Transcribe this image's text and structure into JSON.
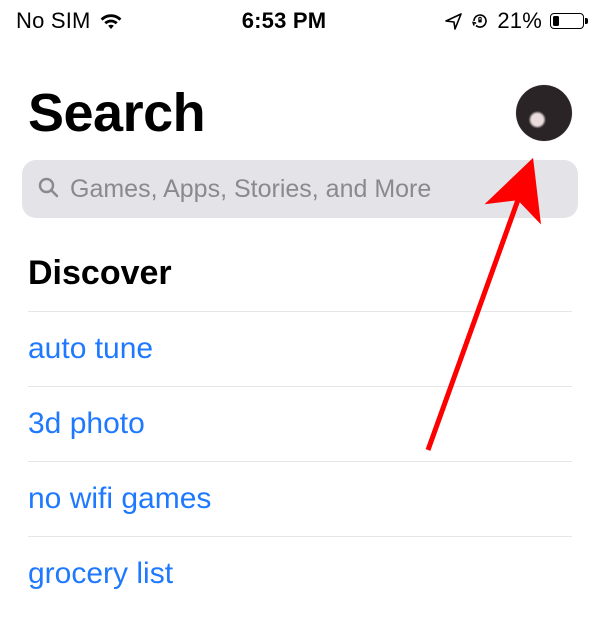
{
  "status_bar": {
    "carrier": "No SIM",
    "time": "6:53 PM",
    "battery_percent_text": "21%",
    "battery_percent": 21
  },
  "header": {
    "title": "Search"
  },
  "search": {
    "placeholder": "Games, Apps, Stories, and More"
  },
  "discover": {
    "title": "Discover",
    "items": [
      "auto tune",
      "3d photo",
      "no wifi games",
      "grocery list"
    ]
  },
  "colors": {
    "link": "#1f79ff",
    "search_bg": "#e4e4e8",
    "annotation_arrow": "#ff0000"
  }
}
